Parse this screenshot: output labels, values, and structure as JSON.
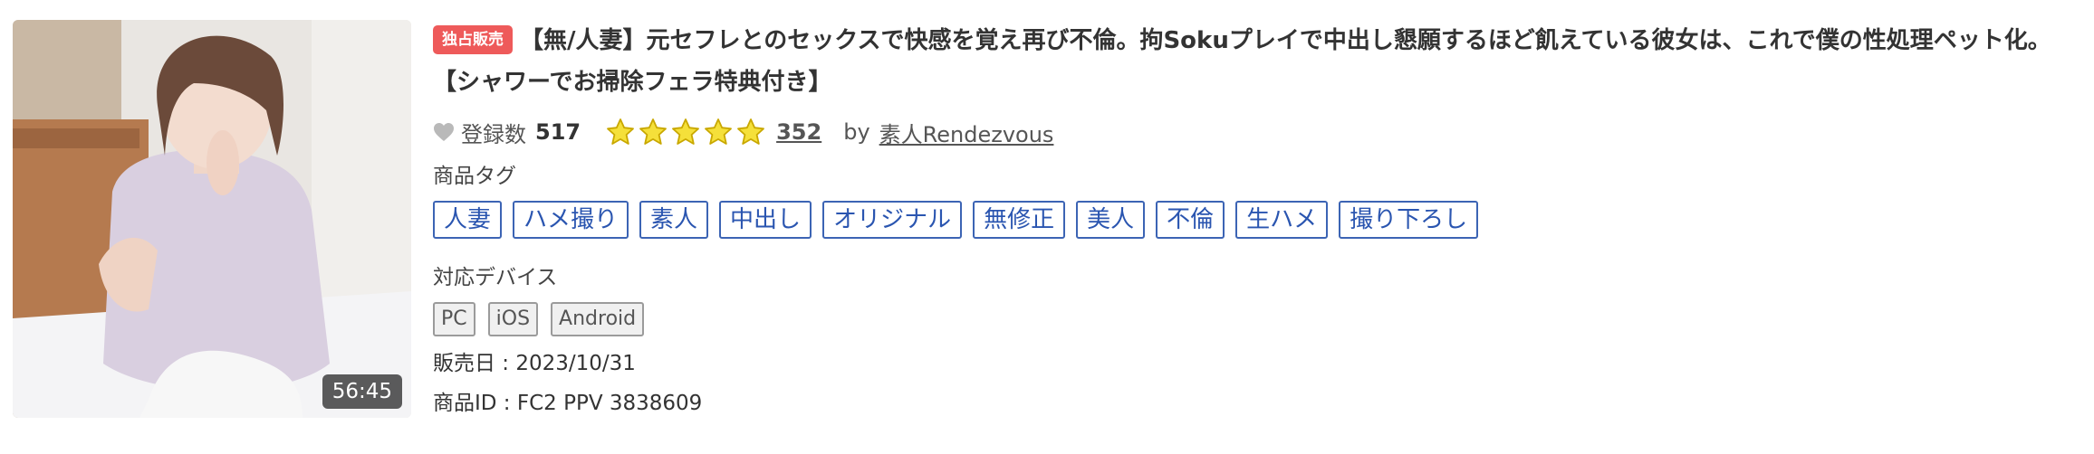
{
  "thumbnail": {
    "duration": "56:45"
  },
  "product": {
    "badge": "独占販売",
    "title": "【無/人妻】元セフレとのセックスで快感を覚え再び不倫。拘Sokuプレイで中出し懇願するほど飢えている彼女は、これで僕の性処理ペット化。【シャワーでお掃除フェラ特典付き】"
  },
  "stats": {
    "favorite_icon": "heart-icon",
    "favorite_label": "登録数",
    "favorite_count": "517",
    "rating_stars": 5,
    "star_icon": "star-icon",
    "review_count": "352",
    "by_label": "by",
    "seller": "素人Rendezvous"
  },
  "tags_section": {
    "label": "商品タグ",
    "tags": [
      "人妻",
      "ハメ撮り",
      "素人",
      "中出し",
      "オリジナル",
      "無修正",
      "美人",
      "不倫",
      "生ハメ",
      "撮り下ろし"
    ]
  },
  "devices_section": {
    "label": "対応デバイス",
    "devices": [
      "PC",
      "iOS",
      "Android"
    ]
  },
  "details": {
    "sale_date": "販売日 : 2023/10/31",
    "product_id": "商品ID : FC2 PPV 3838609"
  },
  "colors": {
    "badge": "#ee5a5a",
    "tag_border": "#3c64b4",
    "star_fill": "#f5e03a",
    "star_stroke": "#c9a800"
  }
}
